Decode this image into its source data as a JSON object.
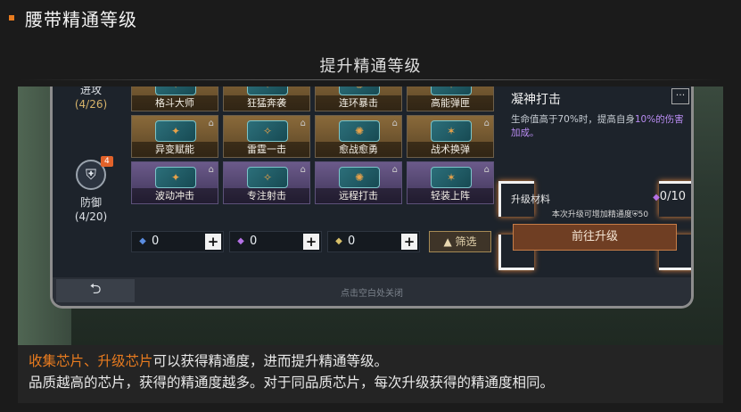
{
  "header": {
    "title": "腰带精通等级"
  },
  "subtitle": "提升精通等级",
  "categories": [
    {
      "label": "进攻",
      "value": "(4/26)"
    },
    {
      "label": "防御",
      "value": "(4/20)",
      "badge": "4"
    }
  ],
  "chips": [
    {
      "label": "格斗大师",
      "locked": false,
      "quality": "gold"
    },
    {
      "label": "狂猛奔袭",
      "locked": false,
      "quality": "gold"
    },
    {
      "label": "连环暴击",
      "locked": false,
      "quality": "gold"
    },
    {
      "label": "高能弹匣",
      "locked": false,
      "quality": "gold"
    },
    {
      "label": "异变赋能",
      "locked": true,
      "quality": "gold"
    },
    {
      "label": "雷霆一击",
      "locked": true,
      "quality": "gold"
    },
    {
      "label": "愈战愈勇",
      "locked": true,
      "quality": "gold"
    },
    {
      "label": "战术换弹",
      "locked": true,
      "quality": "gold"
    },
    {
      "label": "波动冲击",
      "locked": true,
      "quality": "purple"
    },
    {
      "label": "专注射击",
      "locked": true,
      "quality": "purple"
    },
    {
      "label": "远程打击",
      "locked": true,
      "quality": "purple"
    },
    {
      "label": "轻装上阵",
      "locked": true,
      "quality": "purple"
    }
  ],
  "materials": [
    {
      "icon": "blue-chip-icon",
      "count": "0",
      "color": "#5b8de0"
    },
    {
      "icon": "purple-chip-icon",
      "count": "0",
      "color": "#b572e6"
    },
    {
      "icon": "gold-chip-icon",
      "count": "0",
      "color": "#d8c06a"
    }
  ],
  "filter_label": "筛选",
  "skill": {
    "title": "凝神打击",
    "more": "···",
    "desc_prefix": "生命值高于70%时，提高自身",
    "desc_highlight": "10%的伤害加成。"
  },
  "upgrade": {
    "label": "升级材料",
    "count": "0/10",
    "hint": "本次升级可增加精通度",
    "hint_value": "50",
    "button": "前往升级"
  },
  "footer": {
    "back": "⮌",
    "close_hint": "点击空白处关闭"
  },
  "caption": {
    "accent": "收集芯片、升级芯片",
    "line1_rest": "可以获得精通度，进而提升精通等级。",
    "line2": "品质越高的芯片，获得的精通度越多。对于同品质芯片，每次升级获得的精通度相同。"
  },
  "colors": {
    "accent": "#e87b1f",
    "highlight_purple": "#b98cf2"
  }
}
